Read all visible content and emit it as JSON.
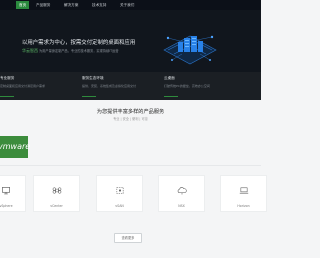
{
  "nav": {
    "items": [
      "首页",
      "产品服务",
      "解决方案",
      "技术支持",
      "关于我们"
    ]
  },
  "hero": {
    "title": "以用户需求为中心，按需交付定制的桌面和应用",
    "brand": "华云智西",
    "subtitle": "为用户量身定制产品，专业的技术服务，实现持续IT运营"
  },
  "features": [
    {
      "title": "专业服务",
      "desc": "定制桌面和应用交付满足用户需求"
    },
    {
      "title": "服务生态环境",
      "desc": "提供、安装、系统集成及虚拟化应用交付"
    },
    {
      "title": "云桌面",
      "desc": "打破传统PC的壁垒，高效办公空间"
    }
  ],
  "products": {
    "title": "为您提供丰富多样的产品服务",
    "subtitle": "专业 | 安全 | 便利 | 可靠",
    "banner_text": "vmware",
    "cards": [
      {
        "label": "vSphere",
        "icon": "monitor-icon"
      },
      {
        "label": "vCenter",
        "icon": "command-icon"
      },
      {
        "label": "vSAN",
        "icon": "dashed-box-icon"
      },
      {
        "label": "NSX",
        "icon": "cloud-icon"
      },
      {
        "label": "Horizon",
        "icon": "laptop-icon"
      }
    ],
    "more_label": "查看更多"
  },
  "colors": {
    "accent": "#2b8a3e",
    "nav_bg": "#0c1018",
    "hero_bg": "#11161d",
    "hero_art": "#1e6fd0"
  }
}
